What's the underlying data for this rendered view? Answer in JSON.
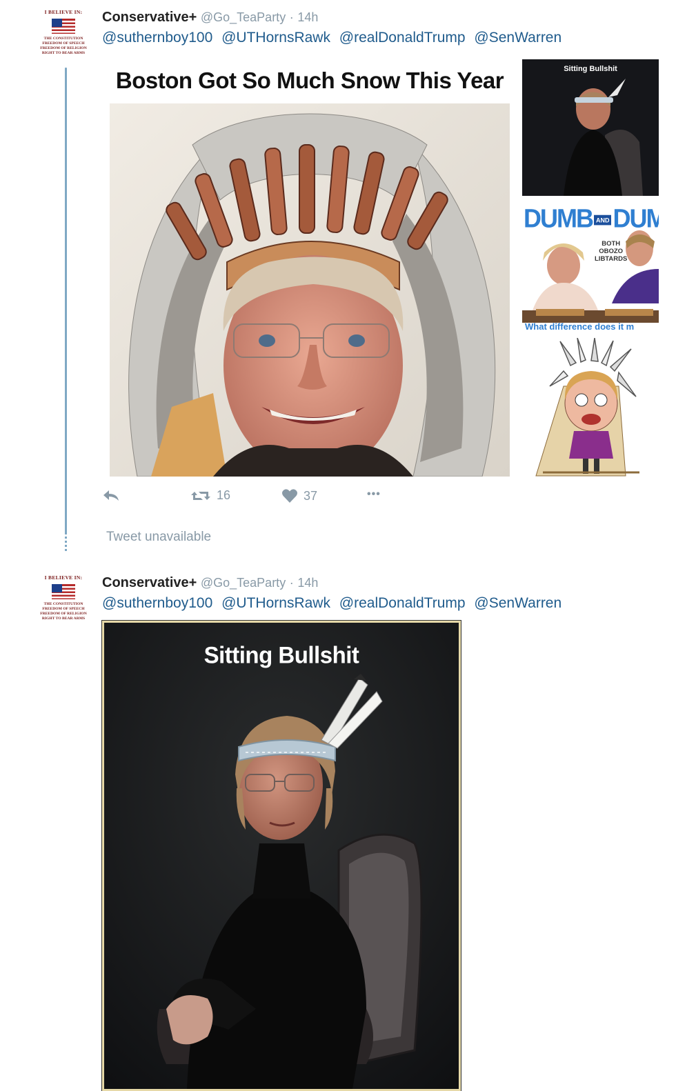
{
  "tweets": [
    {
      "author": {
        "name": "Conservative+",
        "handle": "@Go_TeaParty",
        "separator": "·",
        "time": "14h",
        "avatar_heading": "I BELIEVE IN:",
        "avatar_lines": [
          "THE CONSTITUTION",
          "FREEDOM OF SPEECH",
          "FREEDOM OF RELIGION",
          "RIGHT TO BEAR ARMS"
        ]
      },
      "mentions": [
        "@suthernboy100",
        "@UTHornsRawk",
        "@realDonaldTrump",
        "@SenWarren"
      ],
      "media": {
        "main_title": "Boston Got So Much Snow This Year",
        "thumb1_title": "Sitting Bullshit",
        "thumb2_title_left": "DUMB",
        "thumb2_title_and": "AND",
        "thumb2_title_right": "DUMB",
        "thumb2_caption": [
          "BOTH",
          "OBOZO",
          "LIBTARDS"
        ],
        "thumb2_footer": "What difference does it m"
      },
      "actions": {
        "reply_label": "",
        "retweet_count": "16",
        "like_count": "37",
        "more_label": "•••"
      },
      "unavailable_text": "Tweet unavailable"
    },
    {
      "author": {
        "name": "Conservative+",
        "handle": "@Go_TeaParty",
        "separator": "·",
        "time": "14h",
        "avatar_heading": "I BELIEVE IN:",
        "avatar_lines": [
          "THE CONSTITUTION",
          "FREEDOM OF SPEECH",
          "FREEDOM OF RELIGION",
          "RIGHT TO BEAR ARMS"
        ]
      },
      "mentions": [
        "@suthernboy100",
        "@UTHornsRawk",
        "@realDonaldTrump",
        "@SenWarren"
      ],
      "media": {
        "main_title": "Sitting Bullshit"
      }
    }
  ],
  "colors": {
    "accent": "#1f5b8c",
    "muted": "#8899a6",
    "thread_line": "#7fa8c4"
  }
}
